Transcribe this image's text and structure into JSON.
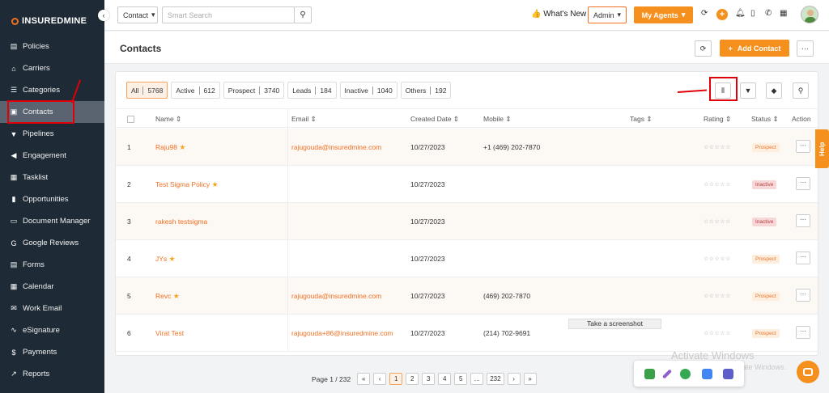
{
  "sidebar": {
    "logo": "INSUREDMINE",
    "collapse_icon": "chevron-left",
    "items": [
      {
        "label": "Policies",
        "icon": "document-icon"
      },
      {
        "label": "Carriers",
        "icon": "bank-icon"
      },
      {
        "label": "Categories",
        "icon": "list-icon"
      },
      {
        "label": "Contacts",
        "icon": "contact-card-icon",
        "active": true
      },
      {
        "label": "Pipelines",
        "icon": "funnel-icon"
      },
      {
        "label": "Engagement",
        "icon": "megaphone-icon"
      },
      {
        "label": "Tasklist",
        "icon": "checklist-icon"
      },
      {
        "label": "Opportunities",
        "icon": "bar-chart-icon"
      },
      {
        "label": "Document Manager",
        "icon": "folder-icon"
      },
      {
        "label": "Google Reviews",
        "icon": "google-icon"
      },
      {
        "label": "Forms",
        "icon": "form-icon"
      },
      {
        "label": "Calendar",
        "icon": "calendar-icon"
      },
      {
        "label": "Work Email",
        "icon": "mail-icon"
      },
      {
        "label": "eSignature",
        "icon": "signature-icon"
      },
      {
        "label": "Payments",
        "icon": "dollar-icon"
      },
      {
        "label": "Reports",
        "icon": "line-chart-icon"
      }
    ]
  },
  "topbar": {
    "entity_select": "Contact",
    "search_placeholder": "Smart Search",
    "whats_new": "What's New",
    "role_select": "Admin",
    "agents_button": "My Agents"
  },
  "header": {
    "title": "Contacts",
    "add_button": "Add Contact"
  },
  "filters": [
    {
      "label": "All",
      "count": "5768",
      "active": true
    },
    {
      "label": "Active",
      "count": "612"
    },
    {
      "label": "Prospect",
      "count": "3740"
    },
    {
      "label": "Leads",
      "count": "184"
    },
    {
      "label": "Inactive",
      "count": "1040"
    },
    {
      "label": "Others",
      "count": "192"
    }
  ],
  "table": {
    "columns": {
      "name": "Name",
      "email": "Email",
      "created": "Created Date",
      "mobile": "Mobile",
      "tags": "Tags",
      "rating": "Rating",
      "status": "Status",
      "action": "Action"
    },
    "rows": [
      {
        "num": "1",
        "name": "Raju98",
        "starred": true,
        "email": "rajugouda@insuredmine.com",
        "created": "10/27/2023",
        "mobile": "+1 (469) 202-7870",
        "status": "Prospect"
      },
      {
        "num": "2",
        "name": "Test Sigma Policy",
        "starred": true,
        "email": "",
        "created": "10/27/2023",
        "mobile": "",
        "status": "Inactive"
      },
      {
        "num": "3",
        "name": "rakesh testsigma",
        "starred": false,
        "email": "",
        "created": "10/27/2023",
        "mobile": "",
        "status": "Inactive"
      },
      {
        "num": "4",
        "name": "JYs",
        "starred": true,
        "email": "",
        "created": "10/27/2023",
        "mobile": "",
        "status": "Prospect"
      },
      {
        "num": "5",
        "name": "Revc",
        "starred": true,
        "email": "rajugouda@insuredmine.com",
        "created": "10/27/2023",
        "mobile": "(469) 202-7870",
        "status": "Prospect"
      },
      {
        "num": "6",
        "name": "Virat Test",
        "starred": false,
        "email": "rajugouda+86@insuredmine.com",
        "created": "10/27/2023",
        "mobile": "(214) 702-9691",
        "status": "Prospect"
      }
    ]
  },
  "pagination": {
    "label": "Page 1 / 232",
    "first": "«",
    "prev": "‹",
    "pages": [
      "1",
      "2",
      "3",
      "4",
      "5",
      "...",
      "232"
    ],
    "next": "›",
    "last": "»"
  },
  "overlays": {
    "help": "Help",
    "tooltip": "Take a screenshot",
    "watermark_title": "Activate Windows",
    "watermark_sub": "Go to Settings to activate Windows."
  },
  "colors": {
    "accent": "#f5901e",
    "sidebar": "#1e2a35",
    "annotation": "#e0000a"
  }
}
